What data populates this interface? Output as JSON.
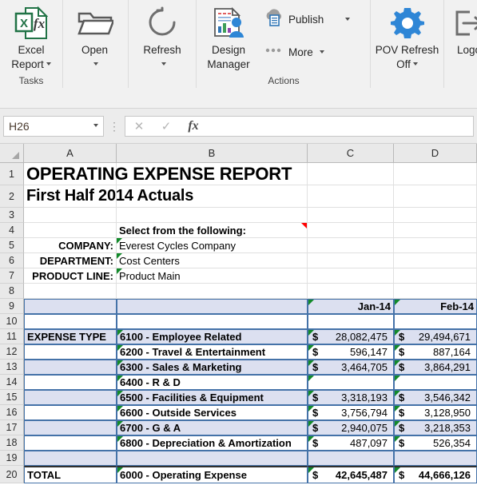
{
  "ribbon": {
    "groups": [
      {
        "label": "Tasks",
        "buttons": [
          {
            "name": "excel-report",
            "label_line1": "Excel",
            "label_line2": "Report",
            "icon": "excel-report-icon",
            "has_caret": true
          },
          {
            "name": "open",
            "label_line1": "Open",
            "label_line2": "",
            "icon": "open-folder-icon",
            "has_caret": true
          }
        ]
      },
      {
        "label": "",
        "buttons": [
          {
            "name": "refresh",
            "label_line1": "Refresh",
            "label_line2": "",
            "icon": "refresh-circular-arrow-icon",
            "has_caret": true
          }
        ]
      },
      {
        "label": "Actions",
        "buttons": [
          {
            "name": "design-manager",
            "label_line1": "Design",
            "label_line2": "Manager",
            "icon": "design-manager-icon",
            "has_caret": false
          },
          {
            "name": "publish",
            "label_line1": "Publish",
            "label_line2": "",
            "icon": "publish-cloud-icon",
            "has_caret": true
          },
          {
            "name": "more",
            "label_line1": "More",
            "label_line2": "",
            "icon": "more-dots-icon",
            "has_caret": true
          },
          {
            "name": "pov-refresh",
            "label_line1": "POV Refresh",
            "label_line2": "Off",
            "icon": "gear-icon",
            "has_caret": true
          }
        ]
      },
      {
        "label": "",
        "buttons": [
          {
            "name": "logoff",
            "label_line1": "Logo",
            "label_line2": "",
            "icon": "logout-arrow-icon",
            "has_caret": false
          }
        ]
      }
    ]
  },
  "formula_bar": {
    "name_box_value": "H26",
    "cancel_icon": "✕",
    "confirm_icon": "✓",
    "function_icon": "fx",
    "formula_value": ""
  },
  "grid": {
    "column_headers": [
      "A",
      "B",
      "C",
      "D"
    ],
    "row_numbers": [
      "1",
      "2",
      "3",
      "4",
      "5",
      "6",
      "7",
      "8",
      "9",
      "10",
      "11",
      "12",
      "13",
      "14",
      "15",
      "16",
      "17",
      "18",
      "19",
      "20"
    ],
    "titles": {
      "line1": "OPERATING EXPENSE REPORT",
      "line2": "First Half 2014 Actuals"
    },
    "prompt": "Select from the following:",
    "pov": [
      {
        "label": "COMPANY:",
        "value": "Everest Cycles Company"
      },
      {
        "label": "DEPARTMENT:",
        "value": "Cost Centers"
      },
      {
        "label": "PRODUCT LINE:",
        "value": "Product Main"
      }
    ],
    "period_headers": {
      "c": "Jan-14",
      "d": "Feb-14"
    },
    "expense_type_label": "EXPENSE TYPE",
    "total_label": "TOTAL",
    "rows": [
      {
        "account": "6100 - Employee Related",
        "jan": "28,082,475",
        "feb": "29,494,671"
      },
      {
        "account": "6200 - Travel & Entertainment",
        "jan": "596,147",
        "feb": "887,164"
      },
      {
        "account": "6300 - Sales & Marketing",
        "jan": "3,464,705",
        "feb": "3,864,291"
      },
      {
        "account": "6400 - R & D",
        "jan": "",
        "feb": ""
      },
      {
        "account": "6500 - Facilities & Equipment",
        "jan": "3,318,193",
        "feb": "3,546,342"
      },
      {
        "account": "6600 - Outside Services",
        "jan": "3,756,794",
        "feb": "3,128,950"
      },
      {
        "account": "6700 - G & A",
        "jan": "2,940,075",
        "feb": "3,218,353"
      },
      {
        "account": "6800 - Depreciation & Amortization",
        "jan": "487,097",
        "feb": "526,354"
      }
    ],
    "total_row": {
      "account": "6000 - Operating Expense",
      "jan": "42,645,487",
      "feb": "44,666,126"
    },
    "currency_symbol": "$"
  },
  "colors": {
    "cell_border": "#4472a8",
    "cell_fill": "#dce0f0",
    "error_triangle": "#128a2a",
    "comment_triangle": "#ff0000",
    "excel_green": "#217346",
    "accent_blue": "#2e75b6"
  }
}
